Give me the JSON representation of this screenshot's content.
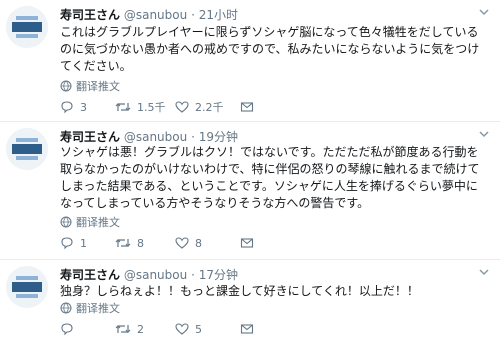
{
  "tweets": [
    {
      "name": "寿司王さん",
      "handle": "@sanubou",
      "sep": "·",
      "time": "21小时",
      "text": "これはグラブルプレイヤーに限らずソシャゲ脳になって色々犠牲をだしている\nのに気づかない愚か者への戒めですので、私みたいにならないように気をつけ\nてください。",
      "translate_label": "翻译推文",
      "reply_count": "3",
      "retweet_count": "1.5千",
      "like_count": "2.2千"
    },
    {
      "name": "寿司王さん",
      "handle": "@sanubou",
      "sep": "·",
      "time": "19分钟",
      "text": "ソシャゲは悪！グラブルはクソ！ではないです。ただただ私が節度ある行動を\n取らなかったのがいけないわけで、特に伴侶の怒りの琴線に触れるまで続けて\nしまった結果である、ということです。ソシャゲに人生を捧げるぐらい夢中に\nなってしまっている方やそうなりそうな方への警告です。",
      "translate_label": "翻译推文",
      "reply_count": "1",
      "retweet_count": "8",
      "like_count": "8"
    },
    {
      "name": "寿司王さん",
      "handle": "@sanubou",
      "sep": "·",
      "time": "17分钟",
      "text": "独身？しらねぇよ！！もっと課金して好きにしてくれ！以上だ！！",
      "translate_label": "翻译推文",
      "reply_count": "",
      "retweet_count": "2",
      "like_count": "5"
    }
  ],
  "colors": {
    "text": "#14171a",
    "muted": "#657786",
    "link": "#1da1f2",
    "divider": "#e6ecf0"
  },
  "icons": [
    "avatar-logo",
    "caret-down-icon",
    "globe-icon",
    "reply-icon",
    "retweet-icon",
    "like-icon",
    "message-icon"
  ]
}
